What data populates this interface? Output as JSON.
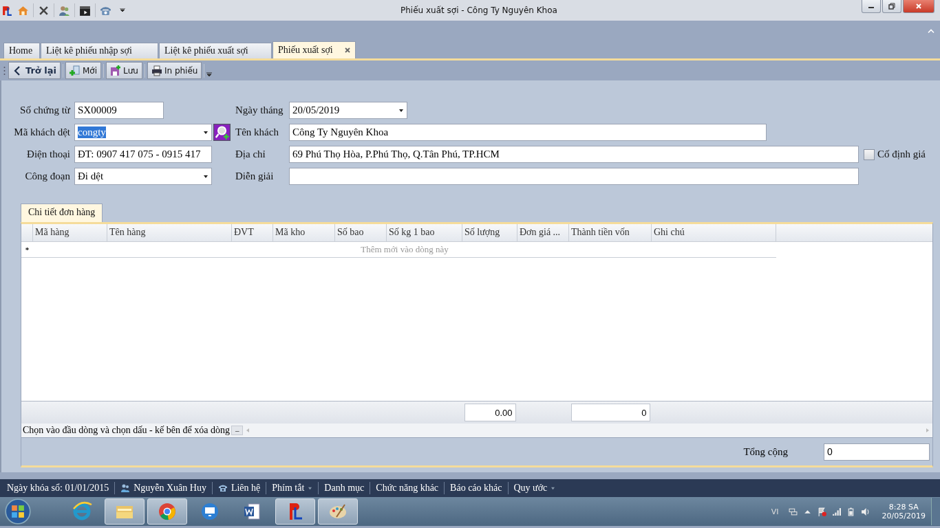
{
  "window": {
    "title": "Phiếu xuất sợi - Công Ty Nguyên Khoa"
  },
  "tabs": [
    {
      "label": "Home",
      "selected": false
    },
    {
      "label": "Liệt kê phiếu  nhập sợi",
      "selected": false
    },
    {
      "label": "Liệt kê phiếu xuất sợi",
      "selected": false
    },
    {
      "label": "Phiếu xuất sợi",
      "selected": true
    }
  ],
  "toolbar": [
    {
      "label": "Trở lại",
      "kind": "back"
    },
    {
      "label": "Mới",
      "kind": "new"
    },
    {
      "label": "Lưu",
      "kind": "save"
    },
    {
      "label": "In phiếu",
      "kind": "print"
    }
  ],
  "form": {
    "rows": [
      {
        "left": {
          "label": "Số chứng từ",
          "value": "SX00009",
          "kind": "text"
        },
        "right": {
          "label": "Ngày tháng",
          "value": "20/05/2019",
          "kind": "combo"
        }
      },
      {
        "left": {
          "label": "Mã khách dệt",
          "value": "congty",
          "kind": "search-combo",
          "selected": true
        },
        "right": {
          "label": "Tên khách",
          "value": "Công Ty Nguyên Khoa",
          "kind": "text"
        }
      },
      {
        "left": {
          "label": "Điện thoại",
          "value": "ĐT: 0907 417 075 - 0915 417",
          "kind": "text"
        },
        "right": {
          "label": "Địa chỉ",
          "value": "69 Phú Thọ Hòa, P.Phú Thọ, Q.Tân Phú, TP.HCM",
          "kind": "text"
        }
      },
      {
        "left": {
          "label": "Công đoạn",
          "value": "Đi dệt",
          "kind": "combo"
        },
        "right": {
          "label": "Diễn giải",
          "kind": "text"
        }
      }
    ],
    "checkbox": {
      "label": "Cố định giá",
      "checked": false
    }
  },
  "detail_tab": {
    "label": "Chi tiết đơn hàng",
    "selected": true
  },
  "grid": {
    "columns": [
      {
        "label": "Mã hàng"
      },
      {
        "label": "Tên hàng"
      },
      {
        "label": "ĐVT"
      },
      {
        "label": "Mã kho"
      },
      {
        "label": "Số bao"
      },
      {
        "label": "Số kg 1 bao"
      },
      {
        "label": "Số lượng",
        "total": "0.00"
      },
      {
        "label": "Đơn giá ..."
      },
      {
        "label": "Thành tiền vốn",
        "total": "0"
      },
      {
        "label": "Ghi chú"
      }
    ],
    "new_row_marker": "*",
    "new_row_text": "Thêm mới vào dòng này",
    "hint": "Chọn vào đầu dòng và chọn dấu - kế bên để xóa dòng",
    "hint_button": "–"
  },
  "total": {
    "label": "Tổng cộng",
    "value": "0"
  },
  "status_bar": [
    {
      "label": "Ngày khóa sổ: 01/01/2015",
      "kind": "plain"
    },
    {
      "label": "Nguyễn Xuân Huy",
      "kind": "user"
    },
    {
      "label": "Liên hệ",
      "kind": "phone"
    },
    {
      "label": "Phím tắt",
      "kind": "menu"
    },
    {
      "label": "Danh mục",
      "kind": "plain"
    },
    {
      "label": "Chức năng khác",
      "kind": "plain"
    },
    {
      "label": "Báo cáo khác",
      "kind": "plain"
    },
    {
      "label": "Quy ước",
      "kind": "menu"
    }
  ],
  "taskbar": {
    "language": "VI",
    "time": "8:28 SA",
    "date": "20/05/2019"
  }
}
